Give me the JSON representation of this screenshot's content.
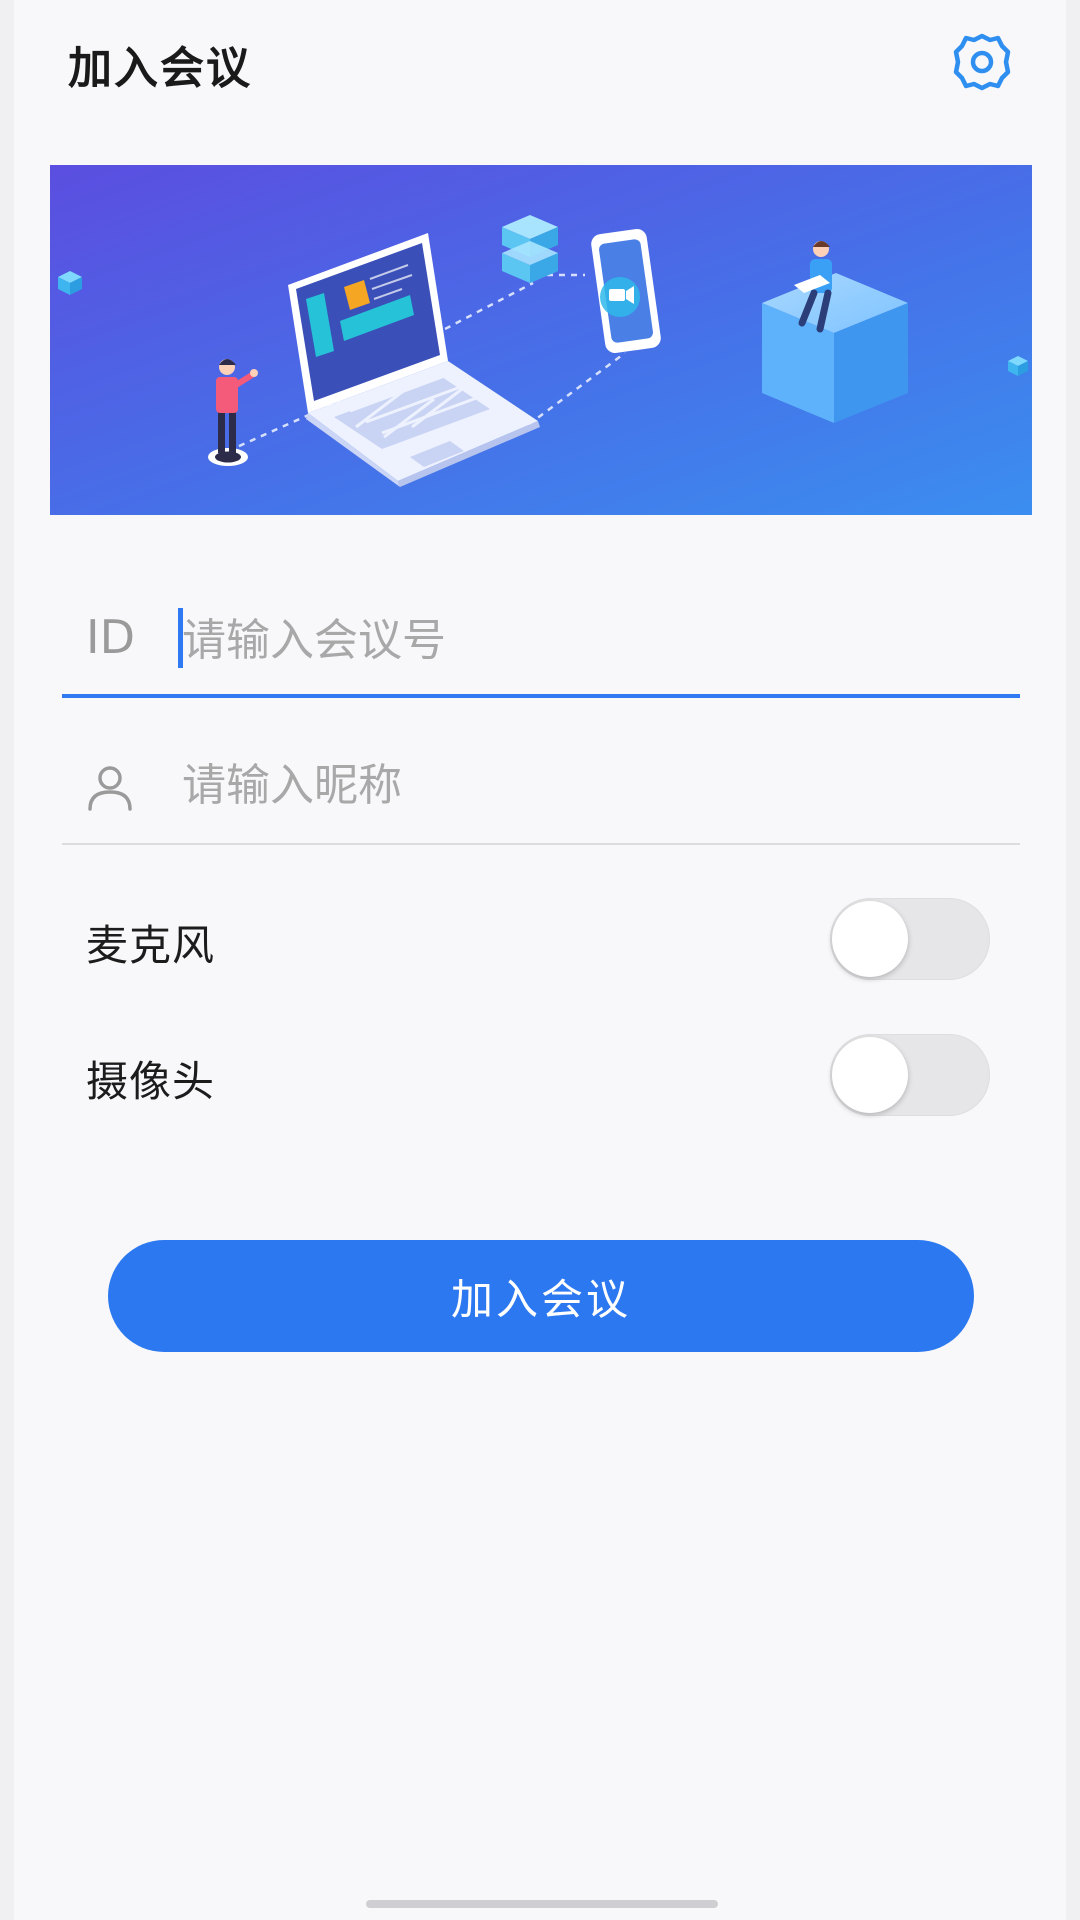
{
  "header": {
    "title": "加入会议",
    "settings_icon": "gear-icon",
    "accent_color": "#2f7af3"
  },
  "banner": {
    "illustration": "video-conference-illustration",
    "gradient_start": "#5a4fe0",
    "gradient_end": "#3b8ef0"
  },
  "form": {
    "meeting_id": {
      "label": "ID",
      "value": "",
      "placeholder": "请输入会议号"
    },
    "nickname": {
      "icon": "user-icon",
      "value": "",
      "placeholder": "请输入昵称"
    }
  },
  "toggles": {
    "microphone": {
      "label": "麦克风",
      "on": false
    },
    "camera": {
      "label": "摄像头",
      "on": false
    }
  },
  "actions": {
    "join_label": "加入会议",
    "button_color": "#2b78f0"
  }
}
